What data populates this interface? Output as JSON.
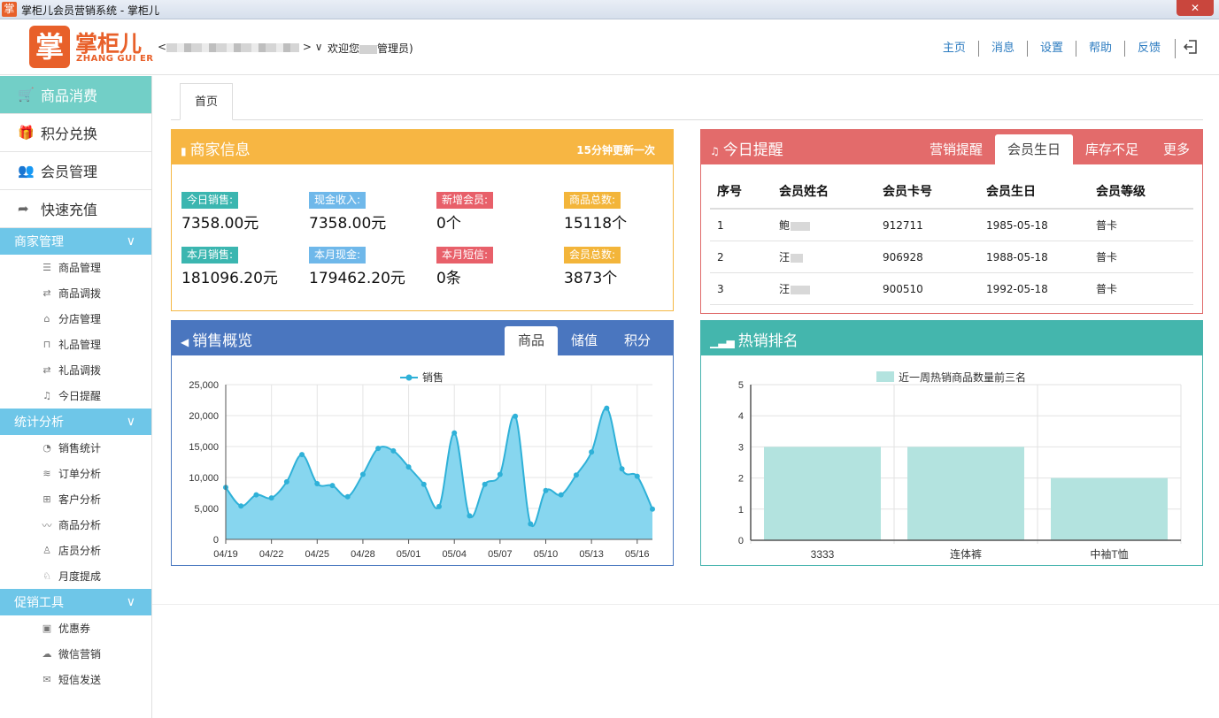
{
  "window": {
    "title": "掌柜儿会员营销系统 - 掌柜儿",
    "logo_glyph": "掌",
    "close_glyph": "✕"
  },
  "header": {
    "logo_cn": "掌柜儿",
    "logo_en": "ZHANG GUI ER",
    "shop_prefix": "<",
    "shop_suffix": "> ∨",
    "welcome_prefix": "欢迎您",
    "welcome_suffix": "管理员)",
    "nav": [
      "主页",
      "消息",
      "设置",
      "帮助",
      "反馈"
    ],
    "logout_icon": "logout-icon"
  },
  "sidebar": {
    "main_items": [
      {
        "label": "商品消费",
        "icon": "cart-icon",
        "glyph": "🛒",
        "active": true
      },
      {
        "label": "积分兑换",
        "icon": "gift-icon",
        "glyph": "🎁"
      },
      {
        "label": "会员管理",
        "icon": "members-icon",
        "glyph": "👥"
      },
      {
        "label": "快速充值",
        "icon": "share-icon",
        "glyph": "➦"
      }
    ],
    "groups": [
      {
        "title": "商家管理",
        "items": [
          {
            "label": "商品管理",
            "glyph": "☰"
          },
          {
            "label": "商品调拨",
            "glyph": "⇄"
          },
          {
            "label": "分店管理",
            "glyph": "⌂"
          },
          {
            "label": "礼品管理",
            "glyph": "⊓"
          },
          {
            "label": "礼品调拨",
            "glyph": "⇄"
          },
          {
            "label": "今日提醒",
            "glyph": "♫"
          }
        ]
      },
      {
        "title": "统计分析",
        "items": [
          {
            "label": "销售统计",
            "glyph": "◔"
          },
          {
            "label": "订单分析",
            "glyph": "≋"
          },
          {
            "label": "客户分析",
            "glyph": "⊞"
          },
          {
            "label": "商品分析",
            "glyph": "〰"
          },
          {
            "label": "店员分析",
            "glyph": "♙"
          },
          {
            "label": "月度提成",
            "glyph": "♘"
          }
        ]
      },
      {
        "title": "促销工具",
        "items": [
          {
            "label": "优惠券",
            "glyph": "▣"
          },
          {
            "label": "微信营销",
            "glyph": "☁"
          },
          {
            "label": "短信发送",
            "glyph": "✉"
          }
        ]
      }
    ]
  },
  "tabs": {
    "home": "首页"
  },
  "merchant": {
    "title": "商家信息",
    "update_note": "15分钟更新一次",
    "stats": [
      {
        "label": "今日销售:",
        "value": "7358.00元",
        "color": "#3bb6b0"
      },
      {
        "label": "现金收入:",
        "value": "7358.00元",
        "color": "#6fb8ea"
      },
      {
        "label": "新增会员:",
        "value": "0个",
        "color": "#e8606a"
      },
      {
        "label": "商品总数:",
        "value": "15118个",
        "color": "#f3b53a"
      },
      {
        "label": "本月销售:",
        "value": "181096.20元",
        "color": "#3bb6b0"
      },
      {
        "label": "本月现金:",
        "value": "179462.20元",
        "color": "#6fb8ea"
      },
      {
        "label": "本月短信:",
        "value": "0条",
        "color": "#e8606a"
      },
      {
        "label": "会员总数:",
        "value": "3873个",
        "color": "#f3b53a"
      }
    ]
  },
  "reminder": {
    "title": "今日提醒",
    "tabs": [
      "营销提醒",
      "会员生日",
      "库存不足",
      "更多"
    ],
    "active_tab": 1,
    "columns": [
      "序号",
      "会员姓名",
      "会员卡号",
      "会员生日",
      "会员等级"
    ],
    "rows": [
      [
        "1",
        "鲍",
        "912711",
        "1985-05-18",
        "普卡"
      ],
      [
        "2",
        "汪",
        "906928",
        "1988-05-18",
        "普卡"
      ],
      [
        "3",
        "汪",
        "900510",
        "1992-05-18",
        "普卡"
      ]
    ]
  },
  "sales": {
    "title": "销售概览",
    "tabs": [
      "商品",
      "储值",
      "积分"
    ],
    "active_tab": 0
  },
  "hot": {
    "title": "热销排名"
  },
  "chart_data": [
    {
      "type": "area",
      "legend": "销售",
      "color": "#2fb1d8",
      "fill": "#87d6ef",
      "ylim": [
        0,
        25000
      ],
      "yticks": [
        "0",
        "5,000",
        "10,000",
        "15,000",
        "20,000",
        "25,000"
      ],
      "xticks": [
        "04/19",
        "04/22",
        "04/25",
        "04/28",
        "05/01",
        "05/04",
        "05/07",
        "05/10",
        "05/13",
        "05/16"
      ],
      "x": [
        "04/19",
        "04/20",
        "04/21",
        "04/22",
        "04/23",
        "04/24",
        "04/25",
        "04/26",
        "04/27",
        "04/28",
        "04/29",
        "04/30",
        "05/01",
        "05/02",
        "05/03",
        "05/04",
        "05/05",
        "05/06",
        "05/07",
        "05/08",
        "05/09",
        "05/10",
        "05/11",
        "05/12",
        "05/13",
        "05/14",
        "05/15",
        "05/16",
        "05/17"
      ],
      "values": [
        8400,
        5400,
        7200,
        6700,
        9300,
        13700,
        9000,
        8700,
        6900,
        10500,
        14700,
        14300,
        11700,
        8900,
        5300,
        17200,
        3800,
        8900,
        10500,
        19900,
        2500,
        7900,
        7200,
        10400,
        14100,
        21200,
        11400,
        10200,
        4900
      ]
    },
    {
      "type": "bar",
      "legend": "近一周热销商品数量前三名",
      "color": "#b3e3df",
      "ylim": [
        0,
        5
      ],
      "yticks": [
        "0",
        "1",
        "2",
        "3",
        "4",
        "5"
      ],
      "categories": [
        "3333",
        "连体裤",
        "中袖T恤"
      ],
      "values": [
        3,
        3,
        2
      ]
    }
  ]
}
